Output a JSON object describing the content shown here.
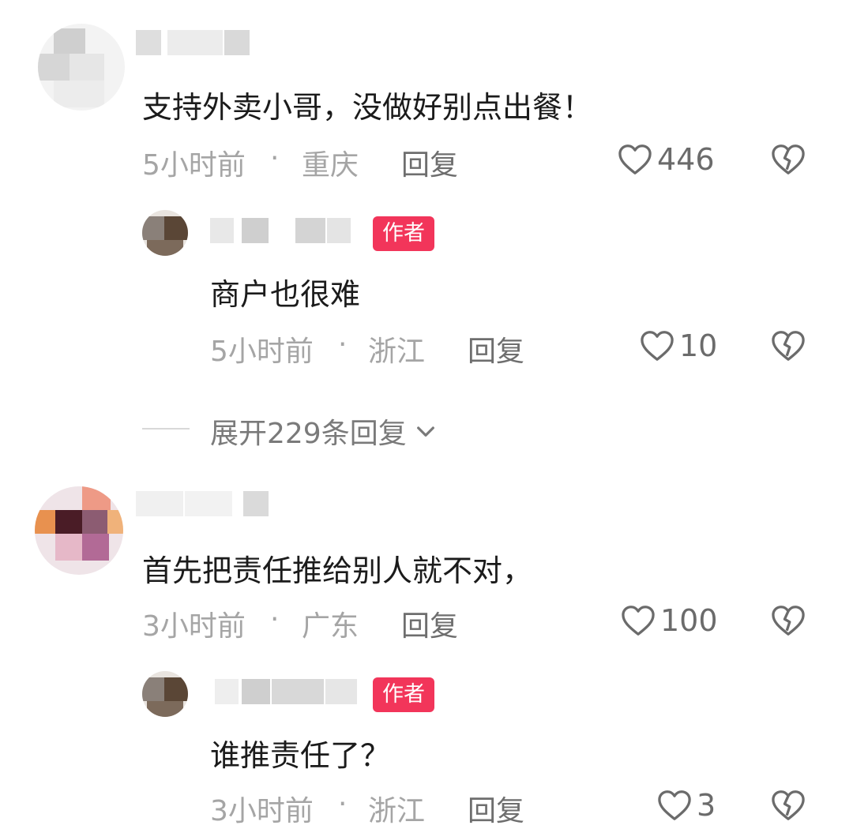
{
  "comments": [
    {
      "text": "支持外卖小哥，没做好别点出餐！",
      "time": "5小时前",
      "location": "重庆",
      "reply_label": "回复",
      "likes": "446",
      "replies": [
        {
          "badge": "作者",
          "text": "商户也很难",
          "time": "5小时前",
          "location": "浙江",
          "reply_label": "回复",
          "likes": "10"
        }
      ],
      "expand_label": "展开229条回复"
    },
    {
      "text": "首先把责任推给别人就不对，",
      "time": "3小时前",
      "location": "广东",
      "reply_label": "回复",
      "likes": "100",
      "replies": [
        {
          "badge": "作者",
          "text": "谁推责任了？",
          "time": "3小时前",
          "location": "浙江",
          "reply_label": "回复",
          "likes": "3"
        }
      ]
    }
  ],
  "separator": "·",
  "icons": {
    "like": "heart-outline-icon",
    "dislike": "broken-heart-icon",
    "expand": "chevron-down-icon"
  },
  "colors": {
    "badge_bg": "#f2355a",
    "text_main": "#1b1b1b",
    "text_meta": "#a5a5a5",
    "icon_gray": "#6b6b6b"
  }
}
